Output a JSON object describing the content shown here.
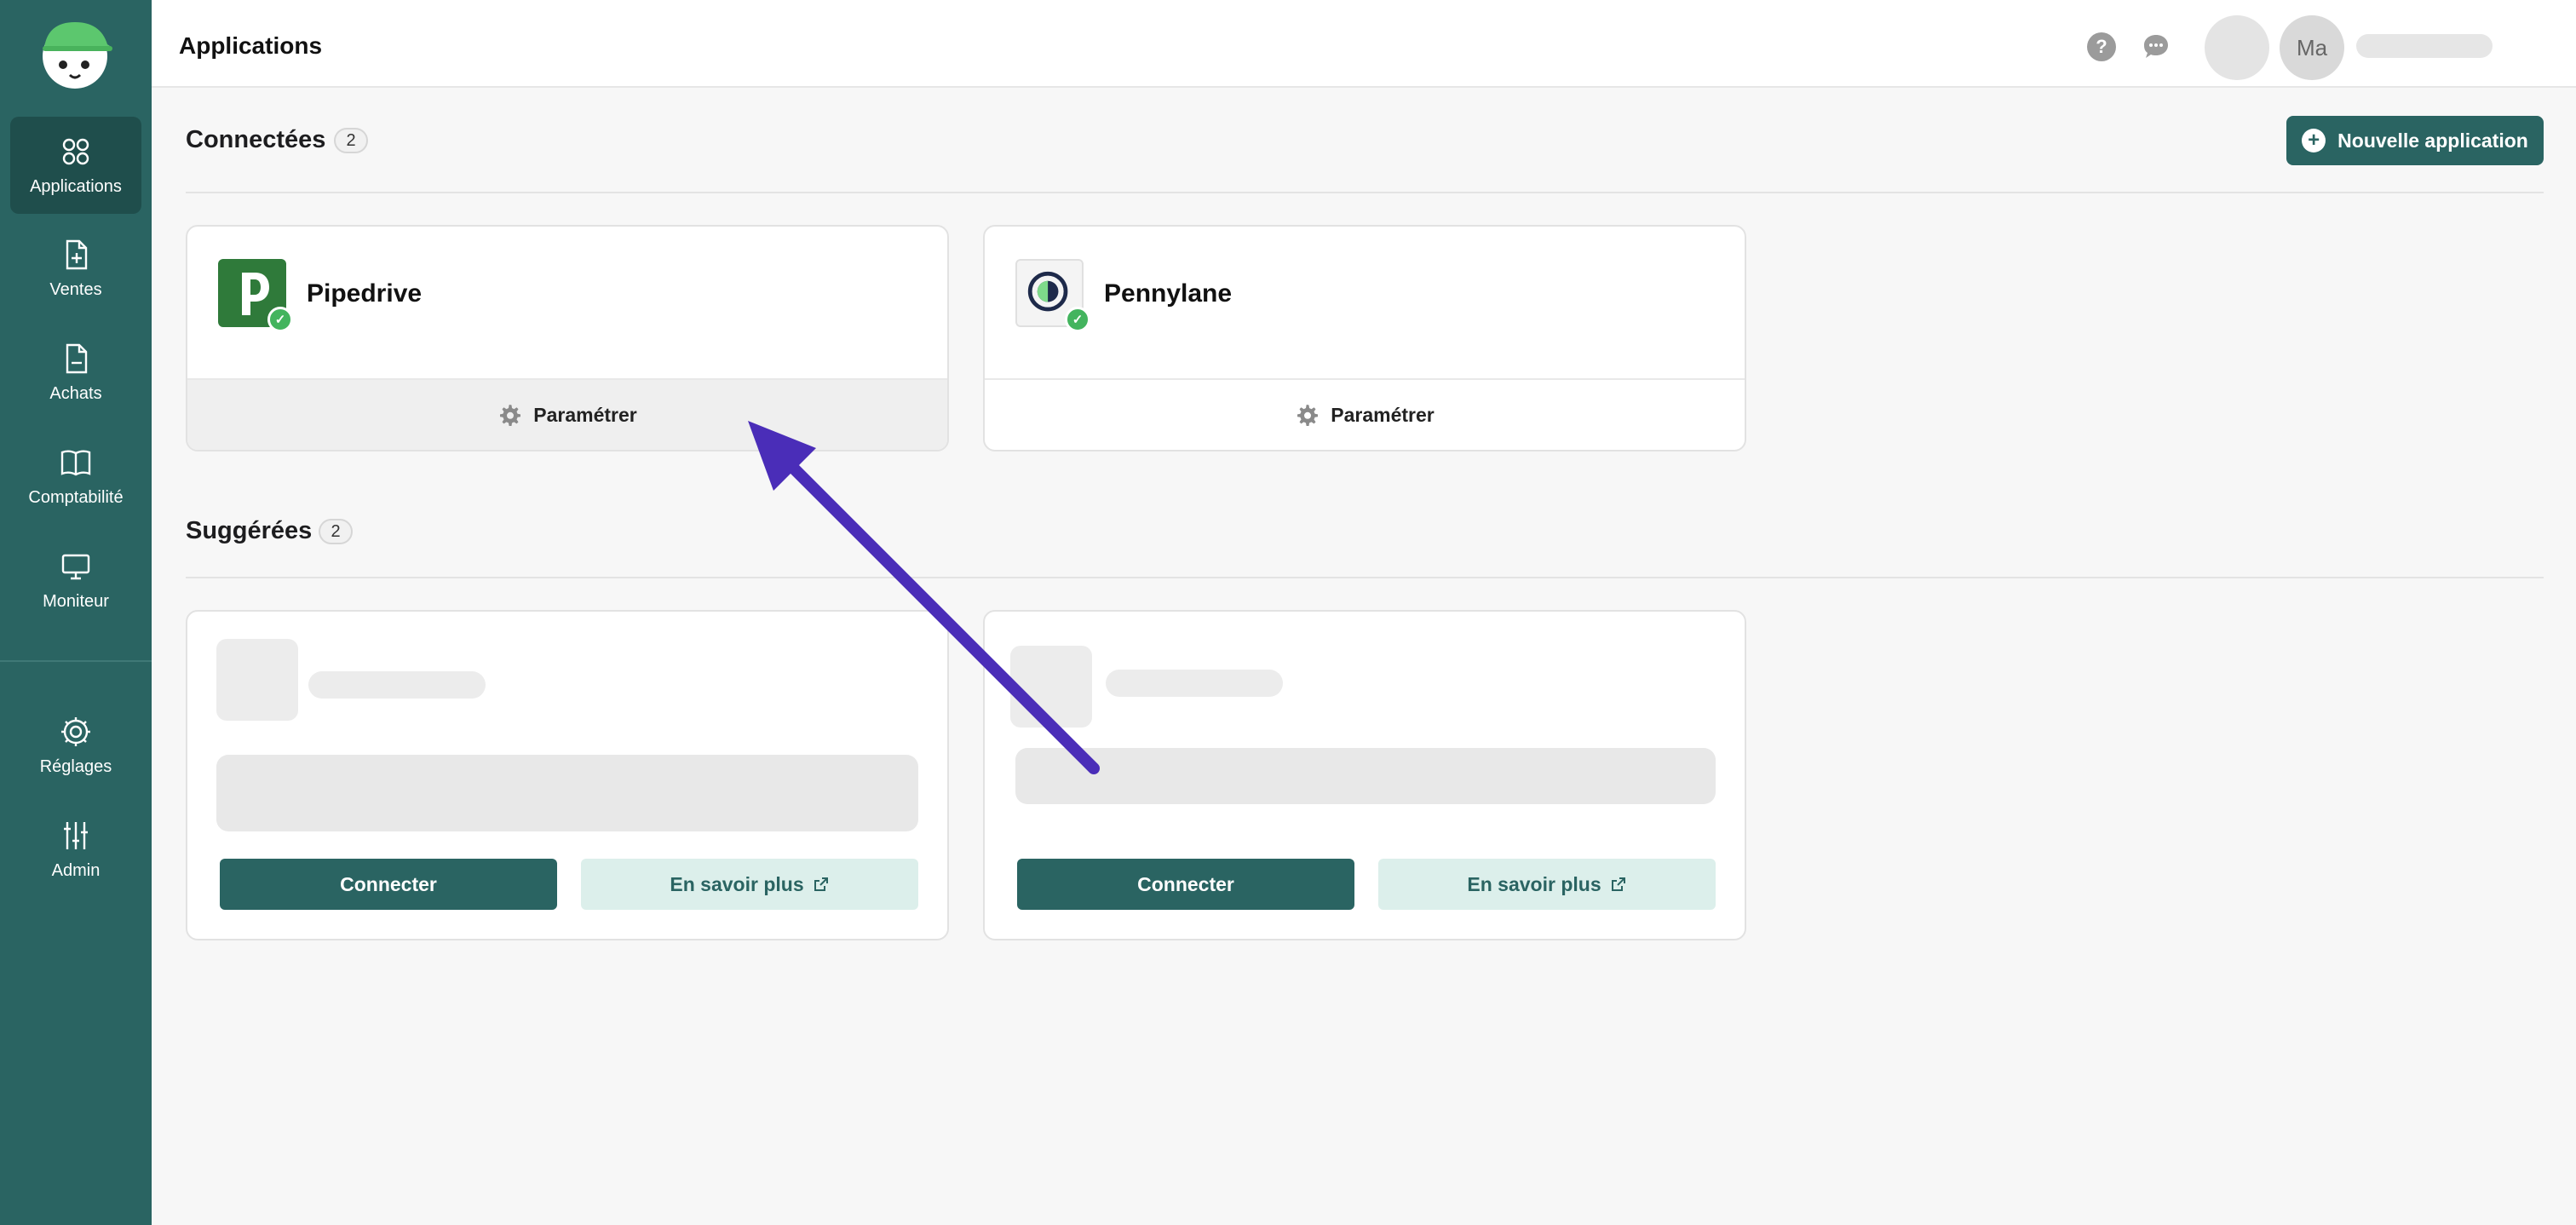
{
  "sidebar": {
    "items": [
      {
        "label": "Applications",
        "icon": "grid-icon",
        "active": true
      },
      {
        "label": "Ventes",
        "icon": "document-plus-icon"
      },
      {
        "label": "Achats",
        "icon": "document-minus-icon"
      },
      {
        "label": "Comptabilité",
        "icon": "book-icon"
      },
      {
        "label": "Moniteur",
        "icon": "monitor-icon"
      },
      {
        "label": "Réglages",
        "icon": "gear-icon"
      },
      {
        "label": "Admin",
        "icon": "sliders-icon"
      }
    ]
  },
  "header": {
    "title": "Applications",
    "avatar_initials": "Ma"
  },
  "connected": {
    "title": "Connectées",
    "count": "2",
    "new_button": "Nouvelle application",
    "cards": [
      {
        "name": "Pipedrive",
        "action": "Paramétrer",
        "logo_letter": "p"
      },
      {
        "name": "Pennylane",
        "action": "Paramétrer"
      }
    ]
  },
  "suggested": {
    "title": "Suggérées",
    "count": "2",
    "cards": [
      {
        "connect": "Connecter",
        "more": "En savoir plus"
      },
      {
        "connect": "Connecter",
        "more": "En savoir plus"
      }
    ]
  },
  "colors": {
    "brand": "#2a6462",
    "brand_dark": "#1f4e4c",
    "success": "#43b45e",
    "annotation_arrow": "#4a2db8",
    "pipedrive": "#2f7a3a"
  }
}
